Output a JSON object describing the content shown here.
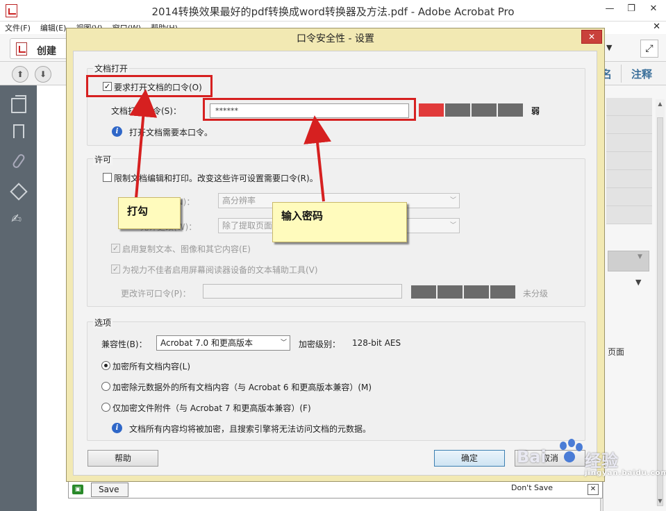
{
  "window": {
    "title": "2014转换效果最好的pdf转换成word转换器及方法.pdf - Adobe Acrobat Pro",
    "minimize": "—",
    "maximize": "❐",
    "close": "✕"
  },
  "menu": {
    "items": [
      "文件(F)",
      "编辑(E)",
      "视图(V)",
      "窗口(W)",
      "帮助(H)"
    ],
    "close_doc": "✕"
  },
  "toolbar": {
    "create_label": "创建",
    "tools_label": "名",
    "comment_label": "注释"
  },
  "right_panel": {
    "text": "页面"
  },
  "bottom_bar": {
    "save_label": "Save",
    "dont_save_label": "Don't Save",
    "close": "✕"
  },
  "dialog": {
    "title": "口令安全性 - 设置",
    "close": "✕",
    "open_group": {
      "title": "文档打开",
      "require_label": "要求打开文档的口令(O)",
      "require_checked": true,
      "password_label": "文档打开口令(S)：",
      "password_value": "******",
      "strength_label": "弱",
      "strength_level": 1,
      "strength_segments": 4,
      "info_text": "打开文档需要本口令。"
    },
    "permissions_group": {
      "title": "许可",
      "restrict_label": "限制文档编辑和打印。改变这些许可设置需要口令(R)。",
      "print_label": "允许打印(N)：",
      "print_value": "高分辨率",
      "change_label": "允许更改(W)：",
      "change_value": "除了提取页面",
      "copy_label": "启用复制文本、图像和其它内容(E)",
      "reader_label": "为视力不佳者启用屏幕阅读器设备的文本辅助工具(V)",
      "perm_password_label": "更改许可口令(P)：",
      "perm_strength_label": "未分级"
    },
    "options_group": {
      "title": "选项",
      "compat_label": "兼容性(B)：",
      "compat_value": "Acrobat 7.0 和更高版本",
      "encrypt_level_label": "加密级别：",
      "encrypt_level_value": "128-bit AES",
      "radio_all": "加密所有文档内容(L)",
      "radio_except_meta": "加密除元数据外的所有文档内容（与 Acrobat 6 和更高版本兼容）(M)",
      "radio_attachments": "仅加密文件附件（与 Acrobat 7 和更高版本兼容）(F)",
      "info_text": "文档所有内容均将被加密，且搜索引擎将无法访问文档的元数据。"
    },
    "help_button": "帮助",
    "ok_button": "确定",
    "cancel_button": "取消"
  },
  "annotations": {
    "check_callout": "打勾",
    "password_callout": "输入密码",
    "box_color": "#d62020"
  },
  "watermark": {
    "brand_left": "Bai",
    "brand_right": "经验",
    "url": "jingyan.baidu.com"
  },
  "colors": {
    "dialog_frame": "#f2e9b3",
    "strength_red": "#e13a3a",
    "left_panel": "#5d6770",
    "link_blue": "#3a6f9a"
  }
}
